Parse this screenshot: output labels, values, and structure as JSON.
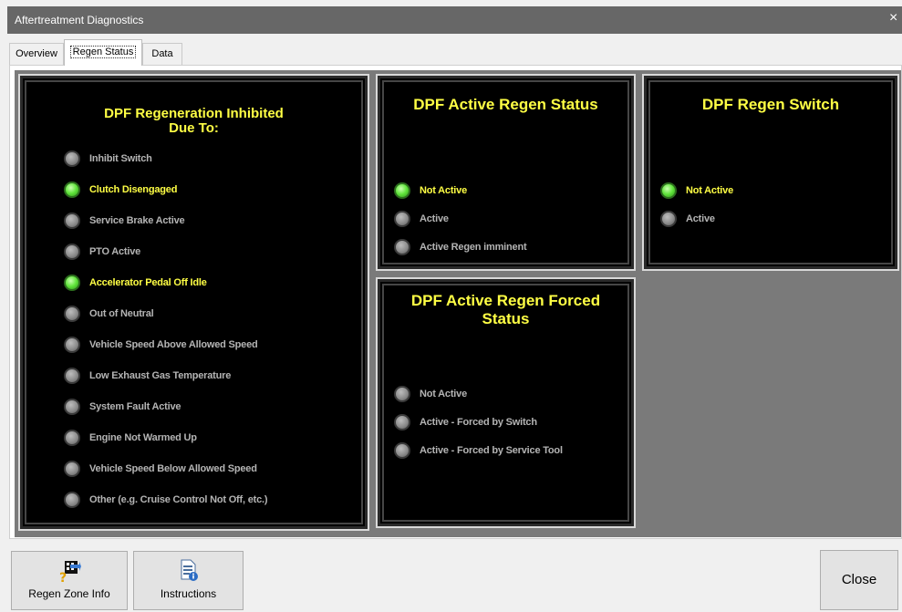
{
  "window": {
    "title": "Aftertreatment Diagnostics",
    "close_symbol": "×"
  },
  "tabs": [
    {
      "label": "Overview",
      "active": false
    },
    {
      "label": "Regen Status",
      "active": true
    },
    {
      "label": "Data",
      "active": false
    }
  ],
  "inhibited": {
    "title_line1": "DPF Regeneration Inhibited",
    "title_line2": "Due To:",
    "items": [
      {
        "label": "Inhibit Switch",
        "on": false
      },
      {
        "label": "Clutch Disengaged",
        "on": true
      },
      {
        "label": "Service Brake Active",
        "on": false
      },
      {
        "label": "PTO Active",
        "on": false
      },
      {
        "label": "Accelerator Pedal Off Idle",
        "on": true
      },
      {
        "label": "Out of Neutral",
        "on": false
      },
      {
        "label": "Vehicle Speed Above Allowed Speed",
        "on": false
      },
      {
        "label": "Low Exhaust Gas Temperature",
        "on": false
      },
      {
        "label": "System Fault Active",
        "on": false
      },
      {
        "label": "Engine Not Warmed Up",
        "on": false
      },
      {
        "label": "Vehicle Speed Below Allowed Speed",
        "on": false
      },
      {
        "label": "Other (e.g. Cruise Control Not Off, etc.)",
        "on": false
      }
    ]
  },
  "active_regen": {
    "title": "DPF Active Regen Status",
    "items": [
      {
        "label": "Not Active",
        "on": true
      },
      {
        "label": "Active",
        "on": false
      },
      {
        "label": "Active Regen imminent",
        "on": false
      }
    ]
  },
  "regen_switch": {
    "title": "DPF Regen Switch",
    "items": [
      {
        "label": "Not Active",
        "on": true
      },
      {
        "label": "Active",
        "on": false
      }
    ]
  },
  "forced": {
    "title_line1": "DPF Active Regen Forced",
    "title_line2": "Status",
    "items": [
      {
        "label": "Not Active",
        "on": false
      },
      {
        "label": "Active - Forced by Switch",
        "on": false
      },
      {
        "label": "Active - Forced by Service Tool",
        "on": false
      }
    ]
  },
  "buttons": {
    "regen_zone_info": "Regen Zone Info",
    "instructions": "Instructions",
    "close": "Close"
  },
  "icons": {
    "regen_zone_info": "question-arrow-icon",
    "instructions": "document-info-icon",
    "lamp_on_color": "#5fe43a",
    "lamp_off_color": "#8d8d8d",
    "label_on_color": "#ffff44",
    "label_off_color": "#b4b4b4"
  }
}
